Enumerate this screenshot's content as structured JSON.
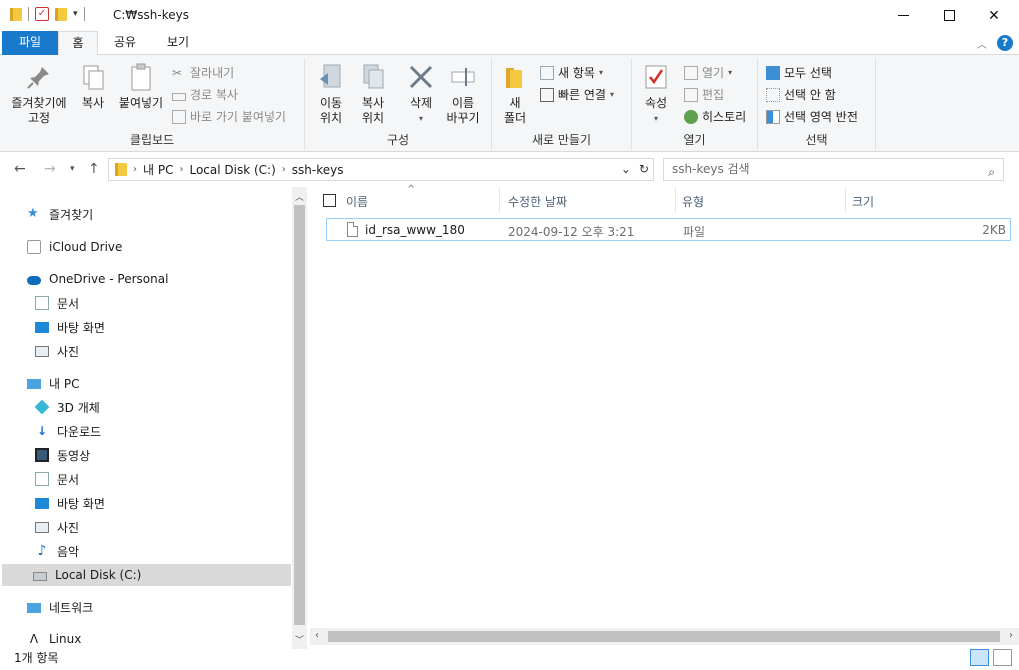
{
  "window": {
    "title": "C:₩ssh-keys"
  },
  "ribbon_tabs": [
    {
      "label": "파일"
    },
    {
      "label": "홈"
    },
    {
      "label": "공유"
    },
    {
      "label": "보기"
    }
  ],
  "ribbon": {
    "clipboard": {
      "pin": "즐겨찾기에\n고정",
      "copy": "복사",
      "paste": "붙여넣기",
      "cut": "잘라내기",
      "copy_path": "경로 복사",
      "paste_shortcut": "바로 가기 붙여넣기",
      "label": "클립보드"
    },
    "organize": {
      "move_to": "이동\n위치",
      "copy_to": "복사\n위치",
      "delete": "삭제",
      "rename": "이름\n바꾸기",
      "label": "구성"
    },
    "new": {
      "new_folder": "새\n폴더",
      "new_item": "새 항목",
      "easy_access": "빠른 연결",
      "label": "새로 만들기"
    },
    "open": {
      "properties": "속성",
      "open": "열기",
      "edit": "편집",
      "history": "히스토리",
      "label": "열기"
    },
    "select": {
      "select_all": "모두 선택",
      "select_none": "선택 안 함",
      "invert": "선택 영역 반전",
      "label": "선택"
    }
  },
  "address": {
    "crumbs": [
      "내 PC",
      "Local Disk (C:)",
      "ssh-keys"
    ],
    "search_placeholder": "ssh-keys 검색"
  },
  "nav": {
    "items": [
      {
        "label": "즐겨찾기"
      },
      {
        "label": "iCloud Drive"
      },
      {
        "label": "OneDrive - Personal"
      },
      {
        "label": "문서"
      },
      {
        "label": "바탕 화면"
      },
      {
        "label": "사진"
      },
      {
        "label": "내 PC"
      },
      {
        "label": "3D 개체"
      },
      {
        "label": "다운로드"
      },
      {
        "label": "동영상"
      },
      {
        "label": "문서"
      },
      {
        "label": "바탕 화면"
      },
      {
        "label": "사진"
      },
      {
        "label": "음악"
      },
      {
        "label": "Local Disk (C:)"
      },
      {
        "label": "네트워크"
      },
      {
        "label": "Linux"
      }
    ]
  },
  "list": {
    "columns": [
      "이름",
      "수정한 날짜",
      "유형",
      "크기"
    ],
    "rows": [
      {
        "name": "id_rsa_www_180",
        "date": "2024-09-12 오후 3:21",
        "type": "파일",
        "size": "2KB"
      }
    ]
  },
  "status": {
    "count": "1개 항목"
  },
  "colors": {
    "accent": "#1979ca",
    "selection": "#d9d9d9",
    "row_border": "#99d1ff"
  }
}
